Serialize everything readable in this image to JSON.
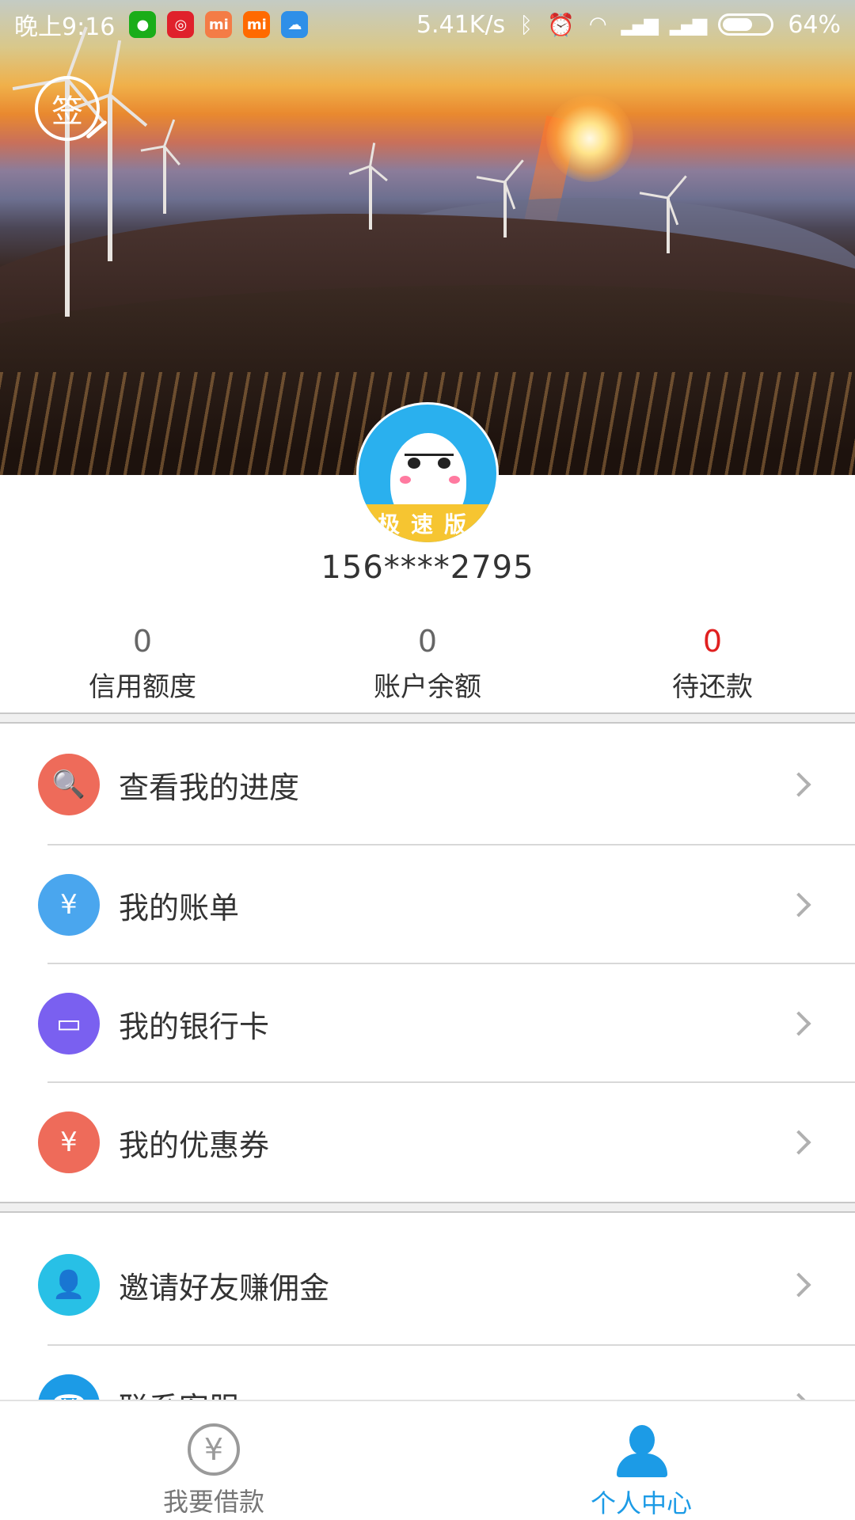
{
  "status_bar": {
    "time": "晚上9:16",
    "network_speed": "5.41K/s",
    "battery": "64%",
    "battery_level": 0.64,
    "apps": [
      {
        "icon": "wechat-icon",
        "color": "#1aad19",
        "glyph": "●"
      },
      {
        "icon": "netease-music-icon",
        "color": "#e0212b",
        "glyph": "◎"
      },
      {
        "icon": "mi-store-icon",
        "color": "#f47c46",
        "glyph": "mi"
      },
      {
        "icon": "mi-app-icon",
        "color": "#ff6a00",
        "glyph": "mi"
      },
      {
        "icon": "cloud-icon",
        "color": "#2f8fe8",
        "glyph": "☁"
      }
    ]
  },
  "header": {
    "signin_glyph": "签",
    "avatar_ribbon": "极速版"
  },
  "profile": {
    "phone": "156****2795"
  },
  "stats": [
    {
      "value": "0",
      "label": "信用额度",
      "highlight": false
    },
    {
      "value": "0",
      "label": "账户余额",
      "highlight": false
    },
    {
      "value": "0",
      "label": "待还款",
      "highlight": true
    }
  ],
  "menu": [
    {
      "label": "查看我的进度",
      "icon": "progress-search-icon",
      "color": "#ee6b5a",
      "glyph": "🔍"
    },
    {
      "label": "我的账单",
      "icon": "bill-icon",
      "color": "#4aa6ee",
      "glyph": "¥"
    },
    {
      "label": "我的银行卡",
      "icon": "bank-card-icon",
      "color": "#7a60f0",
      "glyph": "▭"
    },
    {
      "label": "我的优惠券",
      "icon": "coupon-icon",
      "color": "#ee6b5a",
      "glyph": "¥"
    },
    {
      "label": "邀请好友赚佣金",
      "icon": "invite-friends-icon",
      "color": "#28c0e6",
      "glyph": "👤"
    },
    {
      "label": "联系客服",
      "icon": "customer-service-icon",
      "color": "#1c9be6",
      "glyph": "☎"
    }
  ],
  "bottom_nav": [
    {
      "label": "我要借款",
      "icon": "yen-icon",
      "active": false
    },
    {
      "label": "个人中心",
      "icon": "person-icon",
      "active": true
    }
  ],
  "colors": {
    "accent": "#1c9be6",
    "owed_red": "#e02020"
  }
}
